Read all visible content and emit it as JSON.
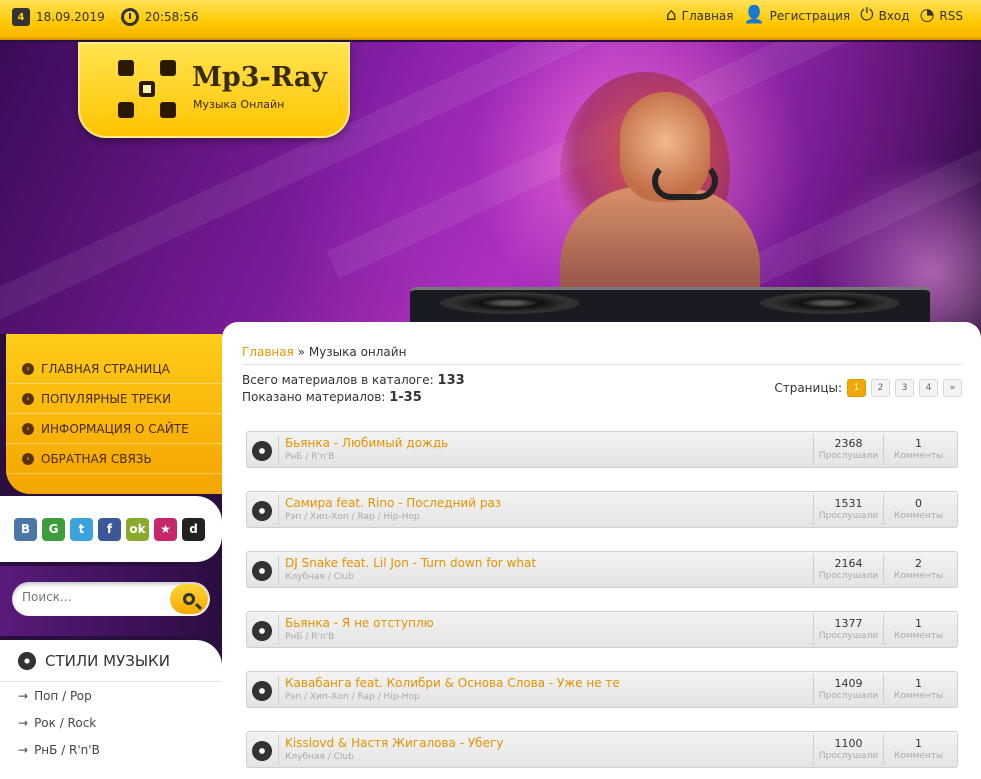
{
  "topbar": {
    "date": "18.09.2019",
    "time": "20:58:56",
    "links": [
      {
        "label": "Главная",
        "icon": "home-icon"
      },
      {
        "label": "Регистрация",
        "icon": "add-user-icon"
      },
      {
        "label": "Вход",
        "icon": "power-icon"
      },
      {
        "label": "RSS",
        "icon": "rss-icon"
      }
    ]
  },
  "logo": {
    "title": "Mp3-Ray",
    "subtitle": "Музыка Онлайн"
  },
  "nav": {
    "items": [
      "ГЛАВНАЯ СТРАНИЦА",
      "ПОПУЛЯРНЫЕ ТРЕКИ",
      "ИНФОРМАЦИЯ О САЙТЕ",
      "ОБРАТНАЯ СВЯЗЬ"
    ]
  },
  "social": {
    "icons": [
      {
        "name": "vk-icon",
        "glyph": "B",
        "color": "#4a76a8"
      },
      {
        "name": "google-icon",
        "glyph": "G",
        "color": "#3d9d3d"
      },
      {
        "name": "twitter-icon",
        "glyph": "t",
        "color": "#3aa3dd"
      },
      {
        "name": "facebook-icon",
        "glyph": "f",
        "color": "#3b5998"
      },
      {
        "name": "odnoklassniki-icon",
        "glyph": "ok",
        "color": "#8aaa2b"
      },
      {
        "name": "myworld-icon",
        "glyph": "★",
        "color": "#c8266a"
      },
      {
        "name": "delicious-icon",
        "glyph": "d",
        "color": "#222222"
      }
    ]
  },
  "search": {
    "placeholder": "Поиск..."
  },
  "styles": {
    "heading": "СТИЛИ МУЗЫКИ",
    "items": [
      "Поп / Pop",
      "Рок / Rock",
      "РнБ / R'n'B"
    ]
  },
  "breadcrumb": {
    "home": "Главная",
    "separator": "»",
    "current": "Музыка онлайн"
  },
  "stats": {
    "total_label": "Всего материалов в каталоге:",
    "total_value": "133",
    "shown_label": "Показано материалов:",
    "shown_value": "1-35"
  },
  "pagination": {
    "label": "Страницы:",
    "pages": [
      "1",
      "2",
      "3",
      "4",
      "»"
    ],
    "active": "1"
  },
  "track_labels": {
    "plays": "Прослушали",
    "comments": "Комменты"
  },
  "tracks": [
    {
      "title": "Бьянка - Любимый дождь",
      "genre": "РнБ / R'n'B",
      "plays": "2368",
      "comments": "1"
    },
    {
      "title": "Самира feat. Rino - Последний раз",
      "genre": "Рэп / Хип-Хоп / Rap / Hip-Hop",
      "plays": "1531",
      "comments": "0"
    },
    {
      "title": "DJ Snake feat. Lil Jon - Turn down for what",
      "genre": "Клубная / Club",
      "plays": "2164",
      "comments": "2"
    },
    {
      "title": "Бьянка - Я не отступлю",
      "genre": "РнБ / R'n'B",
      "plays": "1377",
      "comments": "1"
    },
    {
      "title": "Кавабанга feat. Колибри & Основа Слова - Уже не те",
      "genre": "Рэп / Хип-Хоп / Rap / Hip-Hop",
      "plays": "1409",
      "comments": "1"
    },
    {
      "title": "Kisslovd & Настя Жигалова - Убегу",
      "genre": "Клубная / Club",
      "plays": "1100",
      "comments": "1"
    }
  ]
}
